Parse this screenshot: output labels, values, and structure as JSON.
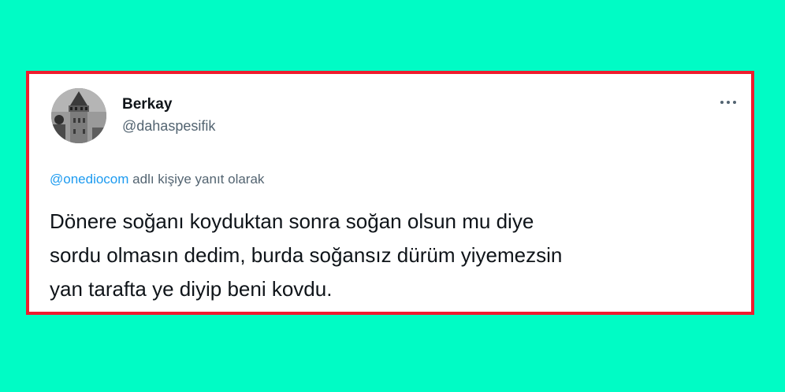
{
  "colors": {
    "background": "#00fcc5",
    "card_border": "#ee1c2e",
    "link": "#1d9bf0",
    "muted_text": "#536471",
    "body_text": "#0f1419"
  },
  "tweet": {
    "author": {
      "display_name": "Berkay",
      "handle": "@dahaspesifik",
      "avatar_icon": "galata-tower-avatar"
    },
    "more_icon": "more-horizontal-icon",
    "reply_context": {
      "mention": "@onediocom",
      "suffix": "adlı kişiye yanıt olarak"
    },
    "text_lines": [
      "Dönere soğanı koyduktan sonra soğan olsun mu diye",
      "sordu olmasın dedim, burda soğansız dürüm yiyemezsin",
      "yan tarafta ye diyip beni kovdu."
    ]
  }
}
